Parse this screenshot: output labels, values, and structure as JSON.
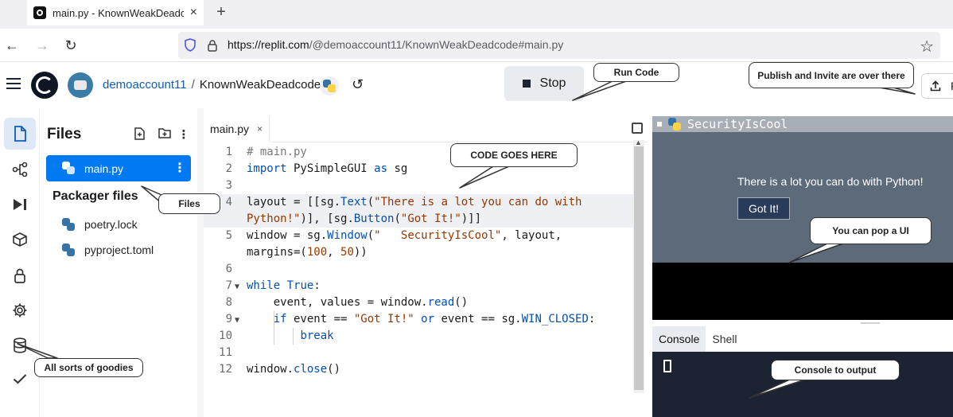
{
  "browser": {
    "tab_title": "main.py - KnownWeakDeadcode",
    "tab_close": "×",
    "new_tab": "+",
    "back": "←",
    "forward": "→",
    "reload": "↻",
    "url_host": "https://replit.com",
    "url_path": "/@demoaccount11/KnownWeakDeadcode#main.py",
    "star": "☆"
  },
  "header": {
    "username": "demoaccount11",
    "separator": "/",
    "repl_name": "KnownWeakDeadcode",
    "history_icon": "↺",
    "stop_label": "Stop",
    "share_label": "P"
  },
  "files": {
    "title": "Files",
    "items": [
      {
        "name": "main.py"
      }
    ],
    "packager_title": "Packager files",
    "packager_items": [
      {
        "name": "poetry.lock"
      },
      {
        "name": "pyproject.toml"
      }
    ]
  },
  "editor": {
    "tab_label": "main.py",
    "tab_close": "×",
    "line_numbers": [
      "1",
      "2",
      "3",
      "4",
      "",
      "5",
      "",
      "6",
      "7",
      "8",
      "9",
      "10",
      "11",
      "12"
    ]
  },
  "output": {
    "window_title": "SecurityIsCool",
    "message": "There is a lot you can do with Python!",
    "button_label": "Got It!"
  },
  "console": {
    "tabs": [
      "Console",
      "Shell"
    ]
  },
  "callouts": {
    "run_code": "Run Code",
    "publish": "Publish and Invite are over there",
    "code_here": "CODE GOES HERE",
    "files": "Files",
    "popup_ui": "You can pop a UI",
    "goodies": "All sorts of goodies",
    "console_output": "Console to output"
  },
  "colors": {
    "accent": "#0079f2",
    "output_bg": "#5d6a7a",
    "console_bg": "#1c2333"
  }
}
